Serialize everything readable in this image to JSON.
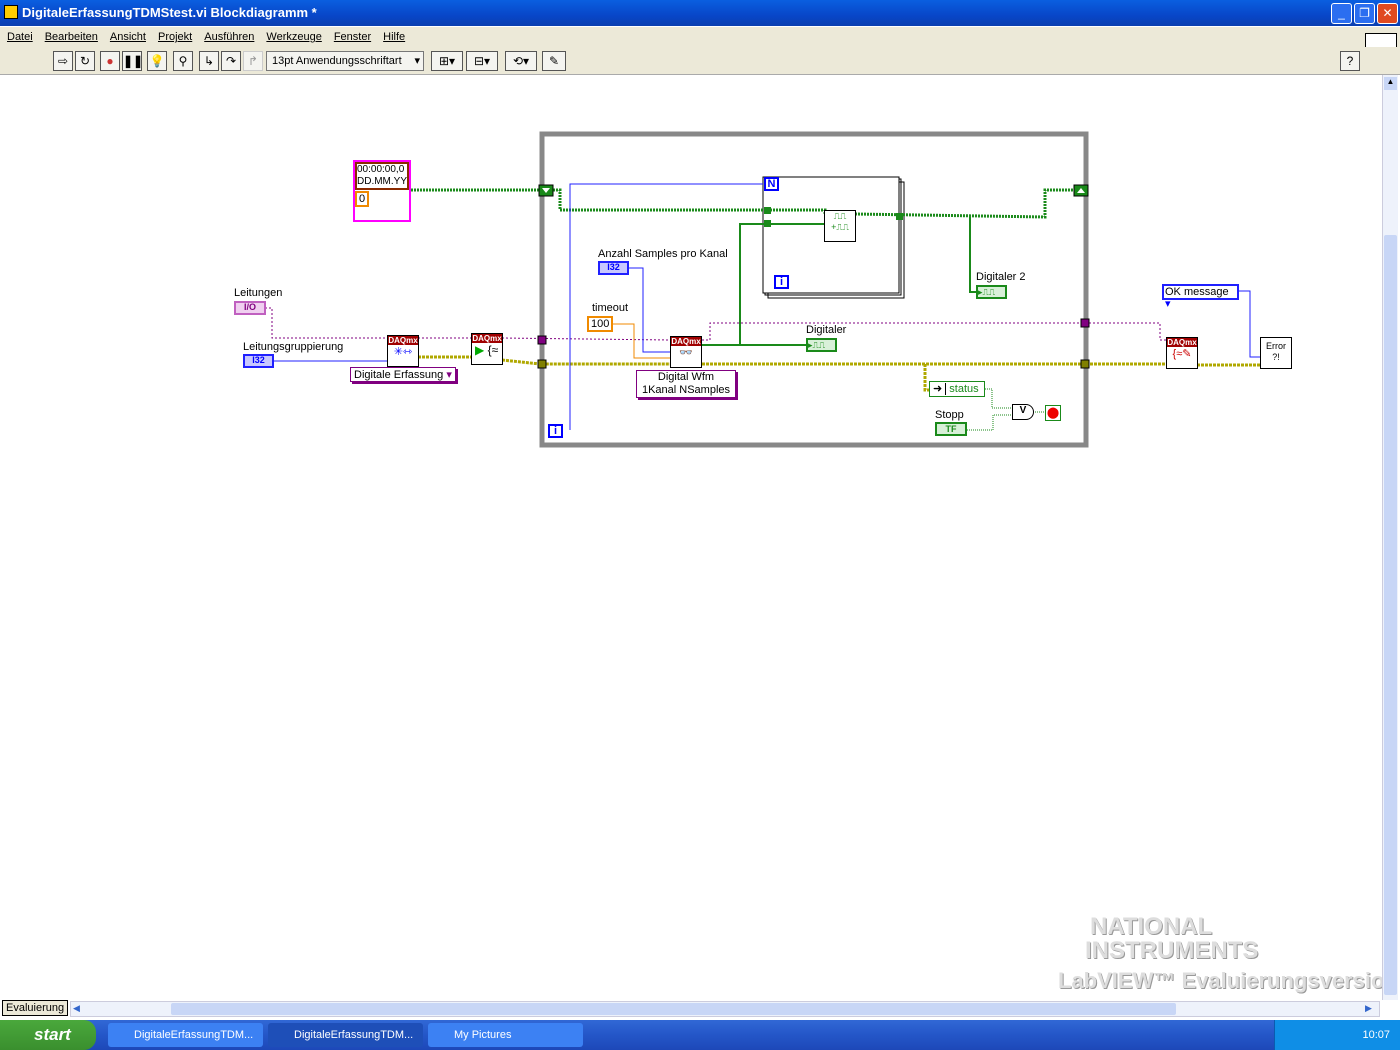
{
  "window": {
    "title": "DigitaleErfassungTDMStest.vi Blockdiagramm *"
  },
  "menu": [
    "Datei",
    "Bearbeiten",
    "Ansicht",
    "Projekt",
    "Ausführen",
    "Werkzeuge",
    "Fenster",
    "Hilfe"
  ],
  "toolbar": {
    "font": "13pt Anwendungsschriftart",
    "help": "?"
  },
  "diagram": {
    "timestamp_line1": "00:00:00,0",
    "timestamp_line2": "DD.MM.YY",
    "timestamp_index": "0",
    "leitungen_label": "Leitungen",
    "leitungen_type": "I/O",
    "gruppierung_label": "Leitungsgruppierung",
    "gruppierung_type": "I32",
    "task_ring": "Digitale Erfassung",
    "samples_label": "Anzahl Samples pro Kanal",
    "samples_type": "I32",
    "timeout_label": "timeout",
    "timeout_value": "100",
    "read_ring_1": "Digital Wfm",
    "read_ring_2": "1Kanal NSamples",
    "daqmx": "DAQmx",
    "digitaler_label": "Digitaler",
    "digitaler2_label": "Digitaler  2",
    "status_label": "status",
    "stopp_label": "Stopp",
    "stopp_type": "TF",
    "ok_message": "OK message",
    "error_label": "Error",
    "n_terminal": "N",
    "i_terminal": "i",
    "or_symbol": "V"
  },
  "watermark": {
    "line1": "NATIONAL",
    "line2": "INSTRUMENTS",
    "line3": "LabVIEW Evaluierungsversion"
  },
  "statusbar": {
    "mode": "Evaluierung"
  },
  "taskbar": {
    "start": "start",
    "tasks": [
      "DigitaleErfassungTDM...",
      "DigitaleErfassungTDM...",
      "My Pictures"
    ],
    "clock": "10:07"
  }
}
